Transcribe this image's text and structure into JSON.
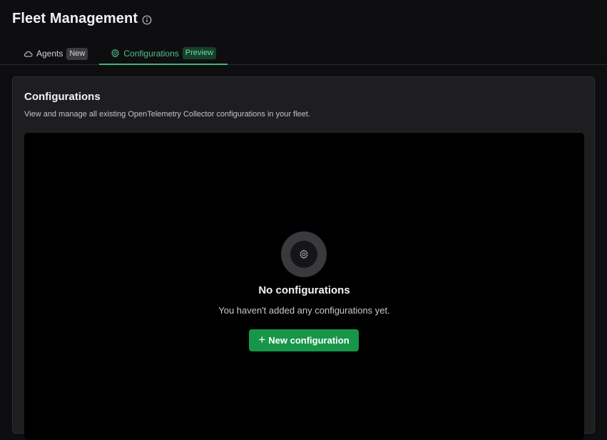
{
  "header": {
    "title": "Fleet Management",
    "info_icon": "info-circle-icon"
  },
  "tabs": [
    {
      "label": "Agents",
      "badge": "New",
      "icon": "cloud-icon",
      "active": false
    },
    {
      "label": "Configurations",
      "badge": "Preview",
      "icon": "gear-icon",
      "active": true
    }
  ],
  "card": {
    "title": "Configurations",
    "description": "View and manage all existing OpenTelemetry Collector configurations in your fleet."
  },
  "empty_state": {
    "icon": "gear-icon",
    "title": "No configurations",
    "description": "You haven't added any configurations yet.",
    "button_label": "New configuration",
    "button_icon": "plus-icon"
  },
  "colors": {
    "accent": "#3fb67a",
    "button": "#17964a",
    "background": "#0e0e10",
    "card": "#1e1e21"
  }
}
